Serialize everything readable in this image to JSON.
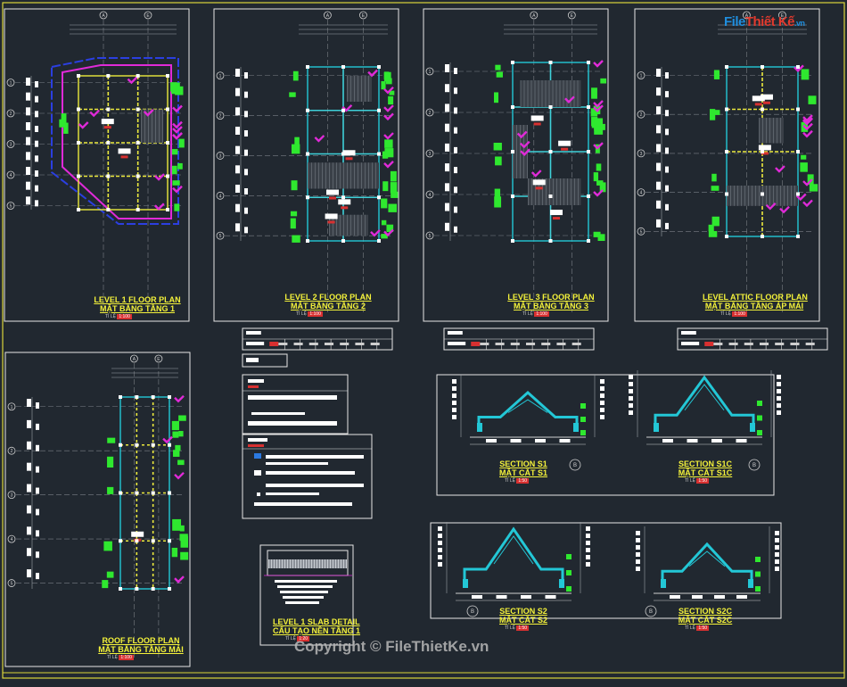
{
  "watermark": "Copyright © FileThietKe.vn",
  "logo": {
    "brand_a": "File",
    "brand_b": "Thiết Kế",
    "brand_c": ".vn"
  },
  "plans": [
    {
      "title_en": "LEVEL 1 FLOOR PLAN",
      "title_vn": "MẶT BẰNG TẦNG 1",
      "scale": "TỈ LỆ",
      "scale_val": "1:100"
    },
    {
      "title_en": "LEVEL 2 FLOOR PLAN",
      "title_vn": "MẶT BẰNG TẦNG 2",
      "scale": "TỈ LỆ",
      "scale_val": "1:100"
    },
    {
      "title_en": "LEVEL 3 FLOOR PLAN",
      "title_vn": "MẶT BẰNG TẦNG 3",
      "scale": "TỈ LỆ",
      "scale_val": "1:100"
    },
    {
      "title_en": "LEVEL ATTIC FLOOR PLAN",
      "title_vn": "MẶT BẰNG TẦNG ÁP MÁI",
      "scale": "TỈ LỆ",
      "scale_val": "1:100"
    },
    {
      "title_en": "ROOF FLOOR PLAN",
      "title_vn": "MẶT BẰNG TẦNG MÁI",
      "scale": "TỈ LỆ",
      "scale_val": "1:100"
    }
  ],
  "sections": [
    {
      "title_en": "SECTION S1",
      "title_vn": "MẶT CẮT S1",
      "scale": "TỈ LỆ",
      "scale_val": "1:50"
    },
    {
      "title_en": "SECTION S1c",
      "title_vn": "MẶT CẮT S1c",
      "scale": "TỈ LỆ",
      "scale_val": "1:50"
    },
    {
      "title_en": "SECTION S2",
      "title_vn": "MẶT CẮT S2",
      "scale": "TỈ LỆ",
      "scale_val": "1:50"
    },
    {
      "title_en": "SECTION S2c",
      "title_vn": "MẶT CẮT S2c",
      "scale": "TỈ LỆ",
      "scale_val": "1:50"
    }
  ],
  "slab_detail": {
    "title_en": "LEVEL 1 SLAB DETAIL",
    "title_vn": "CẤU TẠO NỀN TẦNG 1",
    "scale": "TỈ LỆ",
    "scale_val": "1:20"
  },
  "grid_letters": [
    "A",
    "E"
  ],
  "grid_numbers": [
    "1",
    "2",
    "3",
    "4",
    "5"
  ],
  "colors": {
    "background": "#212830",
    "frame": "#e6e6e6",
    "border_yellow": "#d9d43a",
    "plan_green": "#2fe82f",
    "plan_magenta": "#e02ad8",
    "plan_cyan": "#23c7d6",
    "plan_yellow": "#ecea3d",
    "title_yellow": "#f4f23a",
    "accent_red": "#d83030",
    "property_blue": "#2b3fe0"
  }
}
